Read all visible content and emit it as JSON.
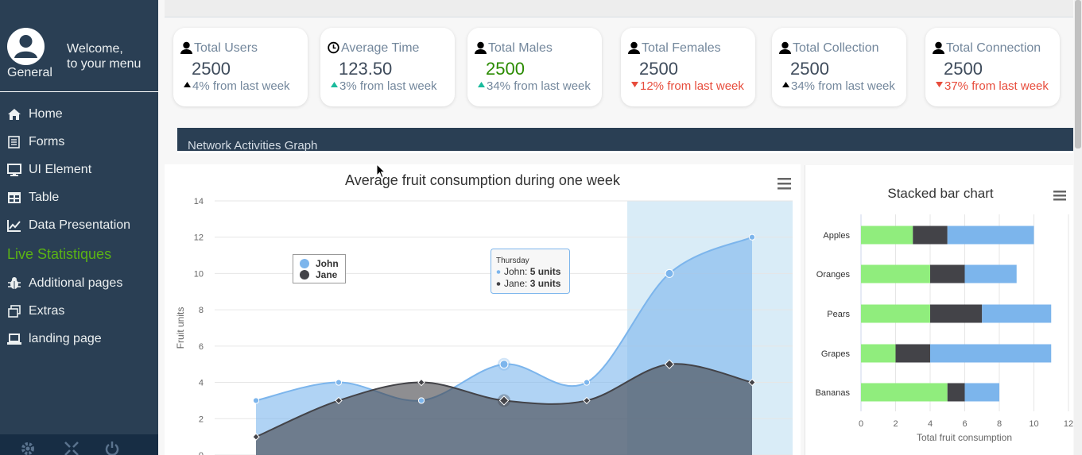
{
  "sidebar": {
    "profile_name": "General",
    "welcome_line1": "Welcome,",
    "welcome_line2": "to your menu",
    "items": [
      {
        "label": "Home",
        "icon": "home-icon"
      },
      {
        "label": "Forms",
        "icon": "forms-icon"
      },
      {
        "label": "UI Element",
        "icon": "desktop-icon"
      },
      {
        "label": "Table",
        "icon": "table-icon"
      },
      {
        "label": "Data Presentation",
        "icon": "chart-icon"
      },
      {
        "label": "Additional pages",
        "icon": "bug-icon"
      },
      {
        "label": "Extras",
        "icon": "windows-icon"
      },
      {
        "label": "landing page",
        "icon": "laptop-icon"
      }
    ],
    "live_label": "Live Statistiques",
    "live_color": "#5bb314",
    "footer_icons": [
      "settings-icon",
      "fullscreen-icon",
      "power-icon"
    ]
  },
  "stats": [
    {
      "label": "Total Users",
      "icon": "user-icon",
      "value": "2500",
      "change": "4%",
      "suffix": " from last week",
      "trend": "up"
    },
    {
      "label": "Average Time",
      "icon": "clock-icon",
      "value": "123.50",
      "change": "3%",
      "suffix": " from last week",
      "trend": "up"
    },
    {
      "label": "Total Males",
      "icon": "user-icon",
      "value": "2500",
      "change": "34%",
      "suffix": " from last week",
      "trend": "up"
    },
    {
      "label": "Total Females",
      "icon": "user-icon",
      "value": "2500",
      "change": "12%",
      "suffix": " from last week",
      "trend": "down"
    },
    {
      "label": "Total Collection",
      "icon": "user-icon",
      "value": "2500",
      "change": "34%",
      "suffix": " from last week",
      "trend": "up"
    },
    {
      "label": "Total Connection",
      "icon": "user-icon",
      "value": "2500",
      "change": "37%",
      "suffix": " from last week",
      "trend": "down"
    }
  ],
  "network": {
    "title": "Network Activities Graph"
  },
  "chart_data": [
    {
      "type": "area",
      "title": "Average fruit consumption during one week",
      "ylabel": "Fruit units",
      "xlabel": "",
      "ylim": [
        0,
        14
      ],
      "yticks": [
        0,
        2,
        4,
        6,
        8,
        10,
        12,
        14
      ],
      "grid": true,
      "legend_position": "top-left",
      "series": [
        {
          "name": "John",
          "color": "#7cb5ec",
          "values": [
            3,
            4,
            3,
            5,
            4,
            10,
            12
          ]
        },
        {
          "name": "Jane",
          "color": "#434348",
          "values": [
            1,
            3,
            4,
            3,
            3,
            5,
            4
          ]
        }
      ],
      "tooltip": {
        "title": "Thursday",
        "lines": [
          {
            "name": "John",
            "value": "5 units"
          },
          {
            "name": "Jane",
            "value": "3 units"
          }
        ]
      },
      "menu_icon": "hamburger-icon"
    },
    {
      "type": "bar",
      "title": "Stacked bar chart",
      "orientation": "horizontal",
      "stacked": true,
      "categories": [
        "Apples",
        "Oranges",
        "Pears",
        "Grapes",
        "Bananas"
      ],
      "xlabel": "Total fruit consumption",
      "xlim": [
        0,
        12
      ],
      "xticks": [
        0,
        2,
        4,
        6,
        8,
        10,
        12
      ],
      "series": [
        {
          "color": "#90ed7d",
          "values": [
            3,
            4,
            4,
            2,
            5
          ]
        },
        {
          "color": "#434348",
          "values": [
            2,
            2,
            3,
            2,
            1
          ]
        },
        {
          "color": "#7cb5ec",
          "values": [
            5,
            3,
            4,
            7,
            2
          ]
        }
      ],
      "menu_icon": "hamburger-icon"
    }
  ]
}
